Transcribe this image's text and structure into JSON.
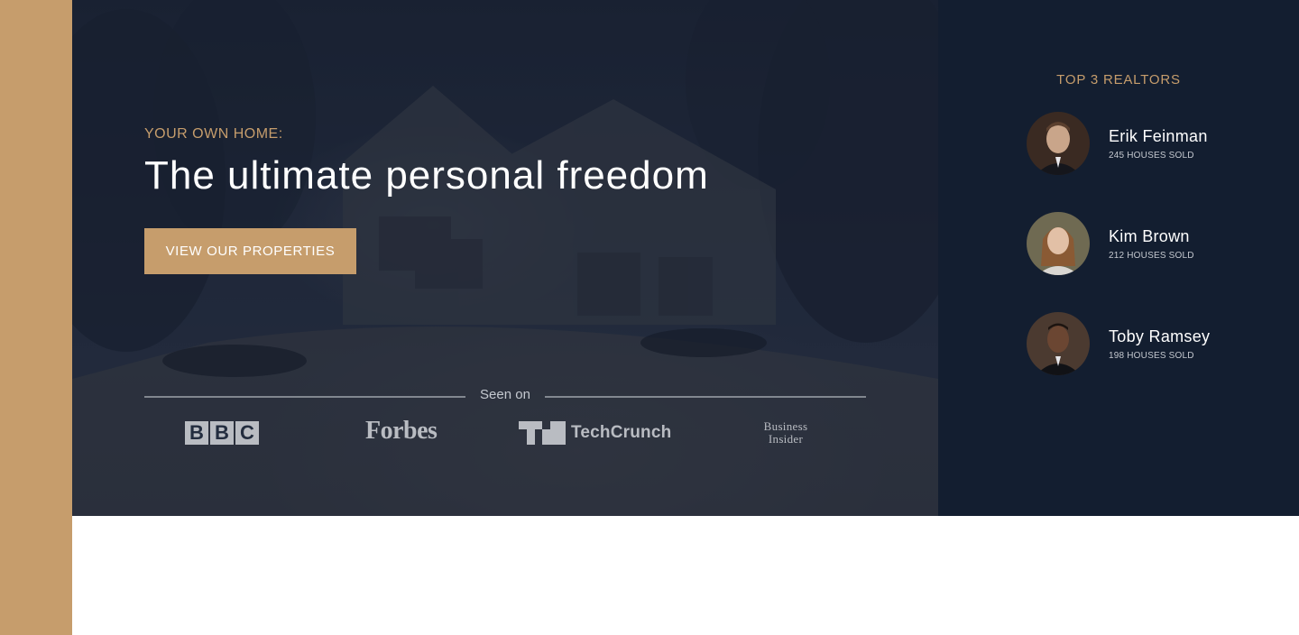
{
  "hero": {
    "kicker": "YOUR OWN HOME:",
    "headline": "The ultimate personal freedom",
    "cta_label": "VIEW OUR PROPERTIES"
  },
  "seen_on": {
    "label": "Seen on",
    "logos": {
      "bbc": [
        "B",
        "B",
        "C"
      ],
      "forbes": "Forbes",
      "techcrunch": "TechCrunch",
      "business_insider": [
        "Business",
        "Insider"
      ]
    }
  },
  "realtors": {
    "title": "TOP 3 REALTORS",
    "items": [
      {
        "name": "Erik Feinman",
        "sold": "245 HOUSES SOLD"
      },
      {
        "name": "Kim Brown",
        "sold": "212 HOUSES SOLD"
      },
      {
        "name": "Toby Ramsey",
        "sold": "198 HOUSES SOLD"
      }
    ]
  },
  "colors": {
    "accent": "#c69d6c",
    "hero_dark": "#232d3f",
    "panel": "#131e30",
    "text_light": "#ffffff",
    "text_muted": "#c4c8cf"
  },
  "icons": {
    "avatars": [
      "realtor-avatar-erik",
      "realtor-avatar-kim",
      "realtor-avatar-toby"
    ]
  }
}
